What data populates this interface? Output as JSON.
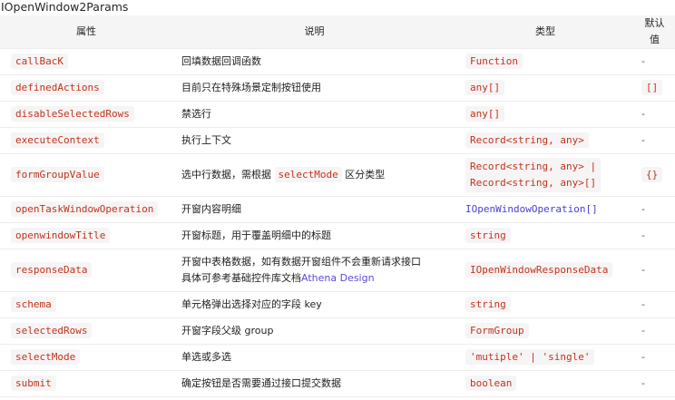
{
  "title": "IOpenWindow2Params",
  "headers": [
    "属性",
    "说明",
    "类型",
    "默认值"
  ],
  "rows": [
    {
      "prop": "callBacK",
      "desc": "回填数据回调函数",
      "type": "Function",
      "default": "-"
    },
    {
      "prop": "definedActions",
      "desc": "目前只在特殊场景定制按钮使用",
      "type": "any[]",
      "default": "[]"
    },
    {
      "prop": "disableSelectedRows",
      "desc": "禁选行",
      "type": "any[]",
      "default": "-"
    },
    {
      "prop": "executeContext",
      "desc": "执行上下文",
      "type": "Record<string, any>",
      "default": "-"
    },
    {
      "prop": "formGroupValue",
      "desc_pre": "选中行数据，需根据",
      "desc_code": "selectMode",
      "desc_post": "区分类型",
      "type_line1": "Record<string, any> |",
      "type_line2": "Record<string, any>[]",
      "default": "{}"
    },
    {
      "prop": "openTaskWindowOperation",
      "desc": "开窗内容明细",
      "type": "IOpenWindowOperation[]",
      "default": "-"
    },
    {
      "prop": "openwindowTitle",
      "desc": "开窗标题，用于覆盖明细中的标题",
      "type": "string",
      "default": "-"
    },
    {
      "prop": "responseData",
      "desc_line1": "开窗中表格数据，如有数据开窗组件不会重新请求接口",
      "desc_line2_pre": "具体可参考基础控件库文档",
      "desc_link": "Athena Design",
      "type": "IOpenWindowResponseData",
      "default": "-"
    },
    {
      "prop": "schema",
      "desc": "单元格弹出选择对应的字段 key",
      "type": "string",
      "default": "-"
    },
    {
      "prop": "selectedRows",
      "desc": "开窗字段父级 group",
      "type": "FormGroup",
      "default": "-"
    },
    {
      "prop": "selectMode",
      "desc": "单选或多选",
      "type": "'mutiple' | 'single'",
      "default": "-"
    },
    {
      "prop": "submit",
      "desc": "确定按钮是否需要通过接口提交数据",
      "type": "boolean",
      "default": "-"
    }
  ]
}
